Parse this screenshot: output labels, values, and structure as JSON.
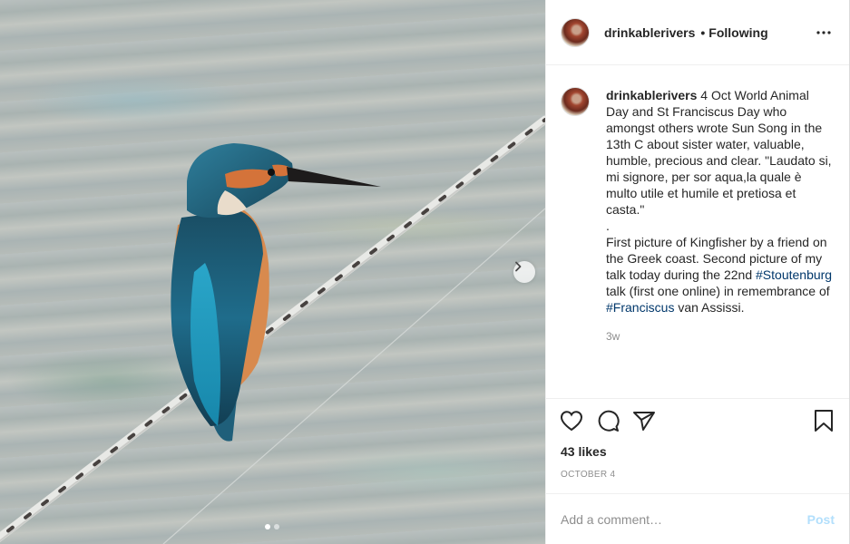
{
  "post": {
    "username": "drinkablerivers",
    "separator": "•",
    "follow_status": "Following",
    "more_icon": "more-horizontal-icon",
    "caption": {
      "username": "drinkablerivers",
      "text_1": "4 Oct World Animal Day and St Franciscus Day who amongst others wrote Sun Song in the 13th C about sister water, valuable, humble, precious and clear. \"Laudato si, mi signore, per sor aqua,la quale è multo utile et humile et pretiosa et casta.\"\n.\nFirst picture of Kingfisher by a friend on the Greek coast. Second picture of my talk today during the 22nd ",
      "tag_1": "#Stoutenburg",
      "text_2": " talk (first one online) in remembrance of ",
      "tag_2": "#Franciscus",
      "text_3": " van Assissi."
    },
    "time_ago": "3w",
    "likes": "43 likes",
    "date": "OCTOBER 4",
    "comment_placeholder": "Add a comment…",
    "post_label": "Post",
    "carousel": {
      "slides": 2,
      "active_index": 0
    },
    "colors": {
      "tag": "#00376b",
      "post_button_disabled": "#b2dffc",
      "muted": "#8e8e8e"
    }
  }
}
